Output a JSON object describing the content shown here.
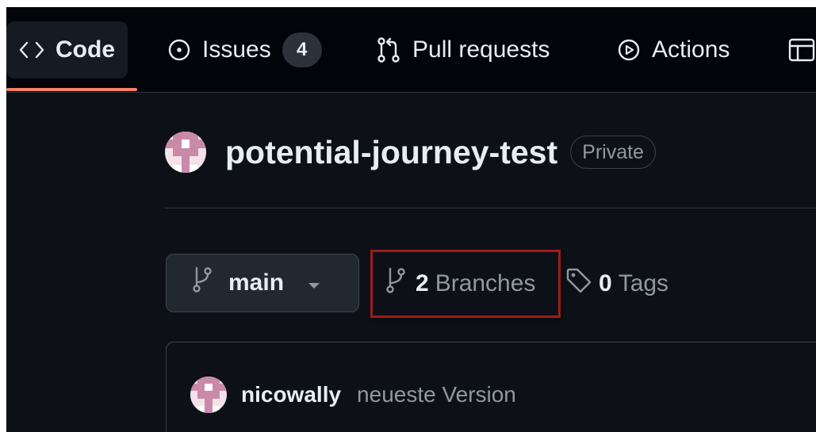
{
  "tabs": {
    "code": {
      "label": "Code",
      "icon": "code-icon"
    },
    "issues": {
      "label": "Issues",
      "icon": "issue-opened-icon",
      "count": "4"
    },
    "pull_requests": {
      "label": "Pull requests",
      "icon": "git-pull-request-icon"
    },
    "actions": {
      "label": "Actions",
      "icon": "play-icon"
    },
    "projects": {
      "icon": "table-icon"
    }
  },
  "repo": {
    "name": "potential-journey-test",
    "visibility": "Private"
  },
  "branch_selector": {
    "label": "main",
    "icon": "git-branch-icon"
  },
  "branches": {
    "count": "2",
    "label": "Branches",
    "icon": "git-branch-icon"
  },
  "tags": {
    "count": "0",
    "label": "Tags",
    "icon": "tag-icon"
  },
  "latest_commit": {
    "author": "nicowally",
    "message": "neueste Version"
  },
  "colors": {
    "background": "#0d1117",
    "tabbar": "#010409",
    "text": "#e6edf3",
    "muted": "#9198a1",
    "active_tab_underline": "#f78166",
    "highlight_box": "#a11b1b"
  }
}
